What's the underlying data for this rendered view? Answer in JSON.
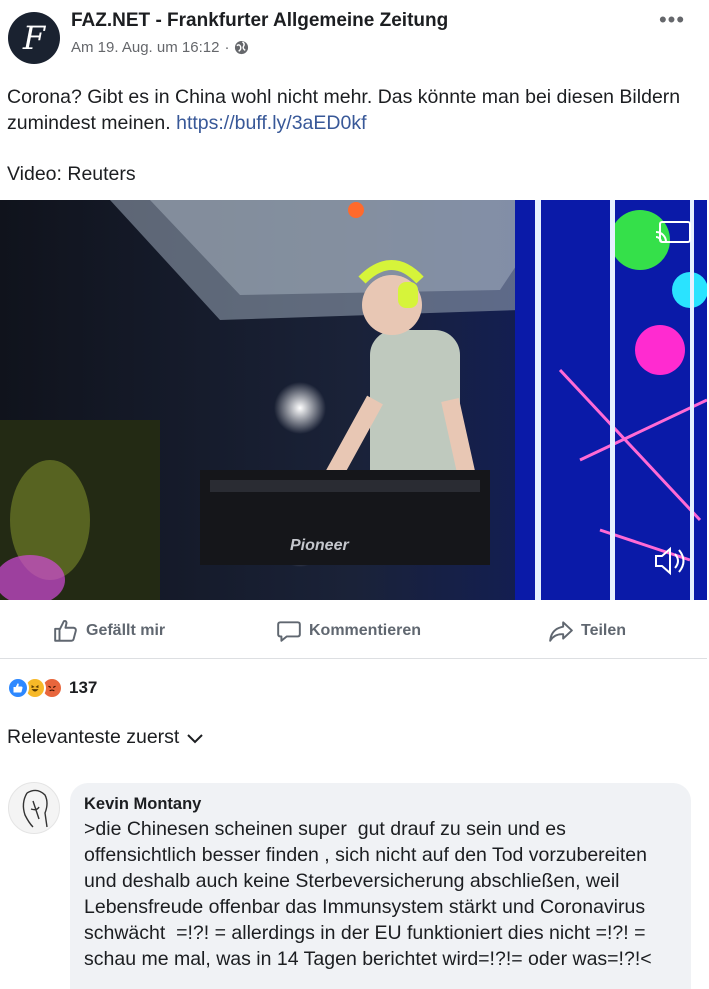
{
  "post": {
    "page_name": "FAZ.NET - Frankfurter Allgemeine Zeitung",
    "timestamp": "Am 19. Aug. um 16:12",
    "separator": "·",
    "privacy_icon": "globe-icon",
    "avatar_letter": "F",
    "more_label": "•••",
    "text_main": "Corona? Gibt es in China wohl nicht mehr. Das könnte man bei diesen Bildern zumindest meinen. ",
    "link": "https://buff.ly/3aED0kf",
    "credit": "Video: Reuters",
    "video_brand_text": "Pioneer"
  },
  "actions": {
    "like_label": "Gefällt mir",
    "comment_label": "Kommentieren",
    "share_label": "Teilen"
  },
  "reactions": {
    "count": "137",
    "types": [
      "like",
      "haha",
      "angry"
    ]
  },
  "sort": {
    "label": "Relevanteste zuerst"
  },
  "comment": {
    "author": "Kevin Montany",
    "text": ">die Chinesen scheinen super  gut drauf zu sein und es offensichtlich besser finden , sich nicht auf den Tod vorzubereiten und deshalb auch keine Sterbeversicherung abschließen, weil  Lebensfreude offenbar das Immunsystem stärkt und Coronavirus schwächt  =!?! = allerdings in der EU funktioniert dies nicht =!?! = schau me mal, was in 14 Tagen berichtet wird=!?!= oder was=!?!<"
  },
  "colors": {
    "link": "#385898",
    "like_blue": "#2d88ff",
    "headphones": "#d6f43a",
    "secondary_text": "#65676b"
  }
}
